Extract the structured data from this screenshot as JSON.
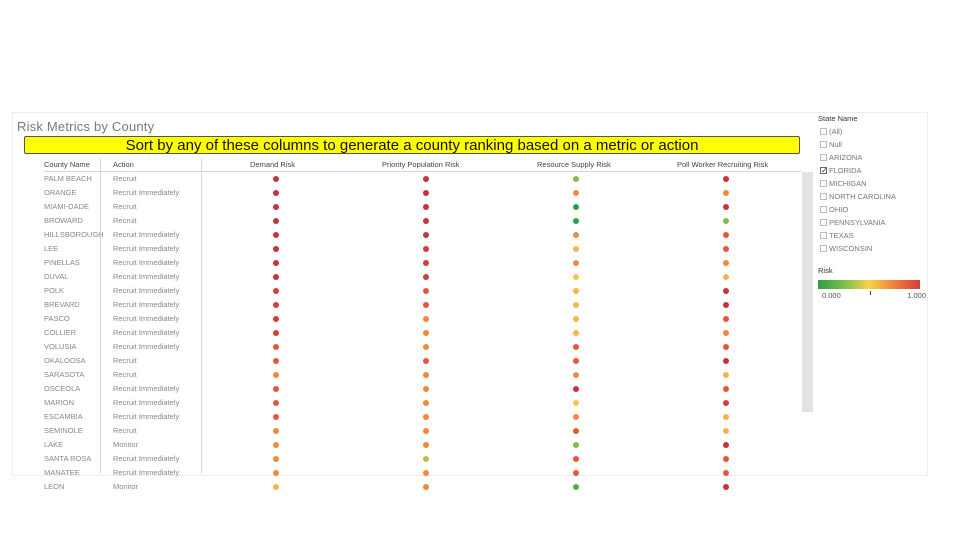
{
  "view_title": "Risk Metrics by County",
  "banner_text": "Sort by any of these columns to generate a county ranking based on a metric or action",
  "table": {
    "headers": [
      "County Name",
      "Action",
      "Demand Risk",
      "Priority Population Risk",
      "Resource Supply Risk",
      "Poll Worker Recruiting Risk"
    ],
    "rows": [
      {
        "county": "PALM BEACH",
        "action": "Recruit",
        "demand": "#c8323b",
        "priority": "#c8323b",
        "resource": "#8cb84a",
        "poll": "#c8323b"
      },
      {
        "county": "ORANGE",
        "action": "Recruit Immediately",
        "demand": "#c8323b",
        "priority": "#c8323b",
        "resource": "#f08a3c",
        "poll": "#f08a3c"
      },
      {
        "county": "MIAMI-DADE",
        "action": "Recruit",
        "demand": "#c8323b",
        "priority": "#c8323b",
        "resource": "#2e9e49",
        "poll": "#c8323b"
      },
      {
        "county": "BROWARD",
        "action": "Recruit",
        "demand": "#c8323b",
        "priority": "#c8323b",
        "resource": "#2e9e49",
        "poll": "#8cb84a"
      },
      {
        "county": "HILLSBOROUGH",
        "action": "Recruit Immediately",
        "demand": "#c8323b",
        "priority": "#c8323b",
        "resource": "#f08a3c",
        "poll": "#e8563a"
      },
      {
        "county": "LEE",
        "action": "Recruit Immediately",
        "demand": "#c8323b",
        "priority": "#d43d3a",
        "resource": "#f5b44a",
        "poll": "#e8563a"
      },
      {
        "county": "PINELLAS",
        "action": "Recruit Immediately",
        "demand": "#c8323b",
        "priority": "#d43d3a",
        "resource": "#f08a3c",
        "poll": "#f08a3c"
      },
      {
        "county": "DUVAL",
        "action": "Recruit Immediately",
        "demand": "#c8323b",
        "priority": "#d43d3a",
        "resource": "#f5c44a",
        "poll": "#f5b44a"
      },
      {
        "county": "POLK",
        "action": "Recruit Immediately",
        "demand": "#d43d3a",
        "priority": "#e8563a",
        "resource": "#f5b44a",
        "poll": "#c8323b"
      },
      {
        "county": "BREVARD",
        "action": "Recruit Immediately",
        "demand": "#d43d3a",
        "priority": "#e8563a",
        "resource": "#f5b44a",
        "poll": "#c8323b"
      },
      {
        "county": "PASCO",
        "action": "Recruit Immediately",
        "demand": "#d43d3a",
        "priority": "#f08a3c",
        "resource": "#f5b44a",
        "poll": "#e8563a"
      },
      {
        "county": "COLLIER",
        "action": "Recruit Immediately",
        "demand": "#d43d3a",
        "priority": "#f08a3c",
        "resource": "#f5b44a",
        "poll": "#f08a3c"
      },
      {
        "county": "VOLUSIA",
        "action": "Recruit Immediately",
        "demand": "#e8563a",
        "priority": "#f08a3c",
        "resource": "#e8563a",
        "poll": "#e8563a"
      },
      {
        "county": "OKALOOSA",
        "action": "Recruit",
        "demand": "#e8563a",
        "priority": "#e8563a",
        "resource": "#e8563a",
        "poll": "#c8323b"
      },
      {
        "county": "SARASOTA",
        "action": "Recruit",
        "demand": "#f08a3c",
        "priority": "#f08a3c",
        "resource": "#f08a3c",
        "poll": "#f5b44a"
      },
      {
        "county": "OSCEOLA",
        "action": "Recruit Immediately",
        "demand": "#e8563a",
        "priority": "#f08a3c",
        "resource": "#c8323b",
        "poll": "#e8563a"
      },
      {
        "county": "MARION",
        "action": "Recruit Immediately",
        "demand": "#e8563a",
        "priority": "#f08a3c",
        "resource": "#f5c44a",
        "poll": "#d43d3a"
      },
      {
        "county": "ESCAMBIA",
        "action": "Recruit Immediately",
        "demand": "#e8563a",
        "priority": "#f08a3c",
        "resource": "#f08a3c",
        "poll": "#f5b44a"
      },
      {
        "county": "SEMINOLE",
        "action": "Recruit",
        "demand": "#f08a3c",
        "priority": "#f08a3c",
        "resource": "#e8563a",
        "poll": "#f5b44a"
      },
      {
        "county": "LAKE",
        "action": "Monitor",
        "demand": "#f08a3c",
        "priority": "#f08a3c",
        "resource": "#8cb84a",
        "poll": "#c8323b"
      },
      {
        "county": "SANTA ROSA",
        "action": "Recruit Immediately",
        "demand": "#f08a3c",
        "priority": "#c8b84a",
        "resource": "#e8563a",
        "poll": "#e8563a"
      },
      {
        "county": "MANATEE",
        "action": "Recruit Immediately",
        "demand": "#f08a3c",
        "priority": "#f08a3c",
        "resource": "#e8563a",
        "poll": "#e8563a"
      },
      {
        "county": "LEON",
        "action": "Monitor",
        "demand": "#f5b44a",
        "priority": "#f08a3c",
        "resource": "#5aa84a",
        "poll": "#c8323b"
      }
    ]
  },
  "filter": {
    "title": "State Name",
    "options": [
      {
        "label": "(All)",
        "checked": false
      },
      {
        "label": "Null",
        "checked": false
      },
      {
        "label": "ARIZONA",
        "checked": false
      },
      {
        "label": "FLORIDA",
        "checked": true
      },
      {
        "label": "MICHIGAN",
        "checked": false
      },
      {
        "label": "NORTH CAROLINA",
        "checked": false
      },
      {
        "label": "OHIO",
        "checked": false
      },
      {
        "label": "PENNSYLVANIA",
        "checked": false
      },
      {
        "label": "TEXAS",
        "checked": false
      },
      {
        "label": "WISCONSIN",
        "checked": false
      }
    ]
  },
  "legend": {
    "title": "Risk",
    "min_label": "0.000",
    "max_label": "1.000",
    "colors": [
      "#2e9e49",
      "#8cc34a",
      "#f5d44a",
      "#f08a3c",
      "#d43d3a"
    ]
  }
}
